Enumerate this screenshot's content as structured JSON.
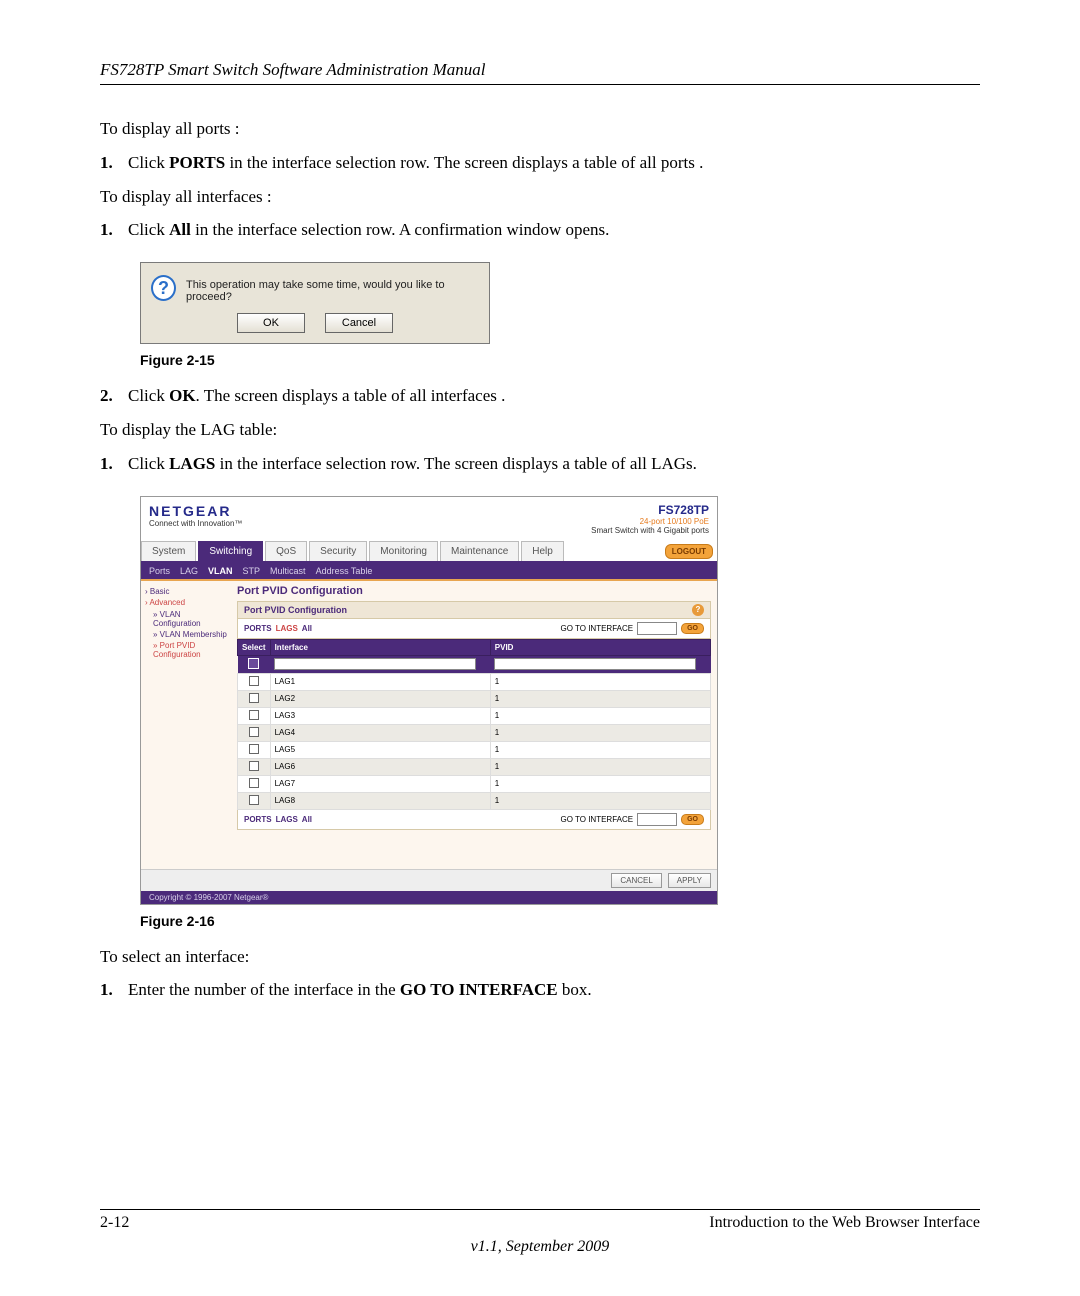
{
  "header": {
    "title": "FS728TP Smart Switch Software Administration Manual"
  },
  "body": {
    "p1": "To display all ports :",
    "step1": {
      "num": "1.",
      "pre": "Click ",
      "bold": "PORTS",
      "post": " in the interface selection row. The screen displays a table of all ports ."
    },
    "p2": "To display all interfaces :",
    "step2": {
      "num": "1.",
      "pre": "Click ",
      "bold": "All",
      "post": " in the interface selection row. A confirmation window opens."
    },
    "fig15": "Figure 2-15",
    "step3": {
      "num": "2.",
      "pre": "Click ",
      "bold": "OK",
      "post": ". The screen displays a table of all interfaces ."
    },
    "p3": "To display the LAG table:",
    "step4": {
      "num": "1.",
      "pre": "Click ",
      "bold": "LAGS",
      "post": " in the interface selection row. The screen displays a table of all LAGs."
    },
    "fig16": "Figure 2-16",
    "p4": "To select an interface:",
    "step5": {
      "num": "1.",
      "pre": "Enter the number of the interface in the ",
      "bold": "GO TO INTERFACE",
      "post": " box."
    }
  },
  "dialog": {
    "icon": "?",
    "text": "This operation may take some time, would you like to proceed?",
    "ok": "OK",
    "cancel": "Cancel"
  },
  "screenshot": {
    "brand": "NETGEAR",
    "tagline": "Connect with Innovation™",
    "model": "FS728TP",
    "model_sub1": "24-port 10/100 PoE",
    "model_sub2": "Smart Switch with 4 Gigabit ports",
    "tabs": [
      "System",
      "Switching",
      "QoS",
      "Security",
      "Monitoring",
      "Maintenance",
      "Help"
    ],
    "active_tab": "Switching",
    "logout": "LOGOUT",
    "subtabs": [
      "Ports",
      "LAG",
      "VLAN",
      "STP",
      "Multicast",
      "Address Table"
    ],
    "active_subtab": "VLAN",
    "sidebar": {
      "basic": "Basic",
      "advanced": "Advanced",
      "items": [
        "VLAN Configuration",
        "VLAN Membership",
        "Port PVID Configuration"
      ]
    },
    "main_title": "Port PVID Configuration",
    "panel_title": "Port PVID Configuration",
    "filters": {
      "ports": "PORTS",
      "lags": "LAGS",
      "all": "All",
      "goto": "GO TO INTERFACE",
      "go": "GO"
    },
    "table": {
      "cols": [
        "Select",
        "Interface",
        "PVID"
      ],
      "rows": [
        {
          "iface": "LAG1",
          "pvid": "1"
        },
        {
          "iface": "LAG2",
          "pvid": "1"
        },
        {
          "iface": "LAG3",
          "pvid": "1"
        },
        {
          "iface": "LAG4",
          "pvid": "1"
        },
        {
          "iface": "LAG5",
          "pvid": "1"
        },
        {
          "iface": "LAG6",
          "pvid": "1"
        },
        {
          "iface": "LAG7",
          "pvid": "1"
        },
        {
          "iface": "LAG8",
          "pvid": "1"
        }
      ]
    },
    "bottom": {
      "cancel": "CANCEL",
      "apply": "APPLY"
    },
    "copyright": "Copyright © 1996-2007 Netgear®"
  },
  "footer": {
    "page": "2-12",
    "chapter": "Introduction to the Web Browser Interface",
    "version": "v1.1, September 2009"
  }
}
